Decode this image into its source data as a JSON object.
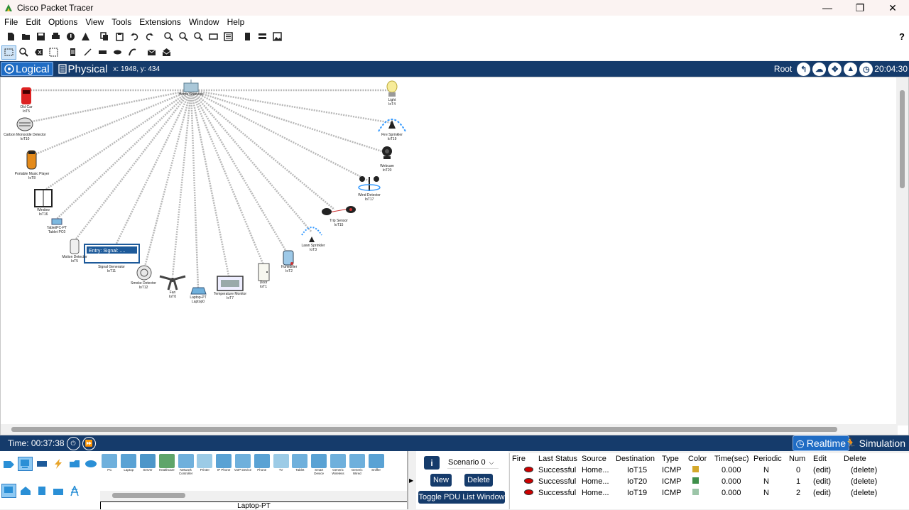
{
  "window": {
    "title": "Cisco Packet Tracer",
    "minimize_icon": "—",
    "restore_icon": "❐",
    "close_icon": "✕"
  },
  "menu": [
    "File",
    "Edit",
    "Options",
    "View",
    "Tools",
    "Extensions",
    "Window",
    "Help"
  ],
  "help_icon": "?",
  "nav": {
    "logical_tab": "Logical",
    "physical_tab": "Physical",
    "coords": "x: 1948, y: 434",
    "root_label": "Root",
    "clock": "20:04:30"
  },
  "devices": [
    {
      "name": "Old Car",
      "id": "IoT5"
    },
    {
      "name": "Carbon Monoxide Detector",
      "id": "IoT10"
    },
    {
      "name": "Portable Music Player",
      "id": "IoT8"
    },
    {
      "name": "Window",
      "id": "IoT16"
    },
    {
      "name": "TabletPC-PT",
      "id": "Tablet PC0"
    },
    {
      "name": "Motion Detector",
      "id": "IoT5"
    },
    {
      "name": "Signal Generator",
      "id": "IoT11"
    },
    {
      "name": "Smoke Detector",
      "id": "IoT12"
    },
    {
      "name": "Fan",
      "id": "IoT0"
    },
    {
      "name": "Laptop-PT",
      "id": "Laptop0"
    },
    {
      "name": "Temperature Monitor",
      "id": "IoT7"
    },
    {
      "name": "Door",
      "id": "IoT1"
    },
    {
      "name": "Humidifier",
      "id": "IoT2"
    },
    {
      "name": "Lawn Sprinkler",
      "id": "IoT3"
    },
    {
      "name": "Trip Sensor",
      "id": "IoT15"
    },
    {
      "name": "Wind Detector",
      "id": "IoT17"
    },
    {
      "name": "Webcam",
      "id": "IoT20"
    },
    {
      "name": "Fire Sprinkler",
      "id": "IoT19"
    },
    {
      "name": "Light",
      "id": "IoT4"
    },
    {
      "name": "Home Gateway",
      "id": ""
    }
  ],
  "signal_generator_display": "Entry: Signal: ....",
  "bottom": {
    "time": "Time: 00:37:38",
    "realtime": "Realtime",
    "simulation": "Simulation"
  },
  "device_palette": {
    "items": [
      "PC",
      "Laptop",
      "Server",
      "Healthcare",
      "Network Controller",
      "Printer",
      "IP Phone",
      "VoIP Device",
      "Phone",
      "TV",
      "Tablet",
      "Smart Device",
      "Generic Wireless",
      "Generic Wired",
      "Sniffer"
    ],
    "selected_name": "Laptop-PT"
  },
  "scenario": {
    "info_icon": "i",
    "selected": "Scenario 0",
    "new_label": "New",
    "delete_label": "Delete",
    "toggle_label": "Toggle PDU List Window"
  },
  "pdu_table": {
    "headers": [
      "Fire",
      "Last Status",
      "Source",
      "Destination",
      "Type",
      "Color",
      "Time(sec)",
      "Periodic",
      "Num",
      "Edit",
      "Delete"
    ],
    "rows": [
      {
        "status": "Successful",
        "source": "Home...",
        "destination": "IoT15",
        "type": "ICMP",
        "color": "#d4a82a",
        "time": "0.000",
        "periodic": "N",
        "num": "0",
        "edit": "(edit)",
        "delete": "(delete)"
      },
      {
        "status": "Successful",
        "source": "Home...",
        "destination": "IoT20",
        "type": "ICMP",
        "color": "#3f8f4a",
        "time": "0.000",
        "periodic": "N",
        "num": "1",
        "edit": "(edit)",
        "delete": "(delete)"
      },
      {
        "status": "Successful",
        "source": "Home...",
        "destination": "IoT19",
        "type": "ICMP",
        "color": "#9cc5a8",
        "time": "0.000",
        "periodic": "N",
        "num": "2",
        "edit": "(edit)",
        "delete": "(delete)"
      }
    ]
  },
  "colors": {
    "nav_bg": "#153b6b",
    "accent": "#1f6cc4"
  }
}
